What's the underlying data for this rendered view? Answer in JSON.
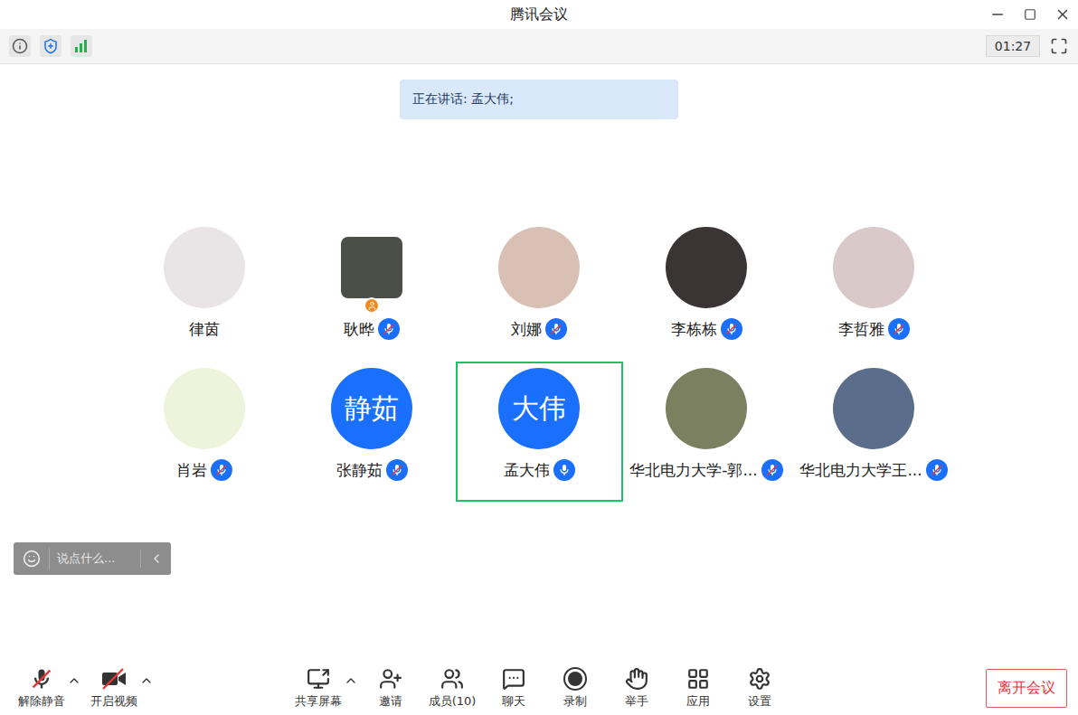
{
  "window": {
    "title": "腾讯会议"
  },
  "statusbar": {
    "timer": "01:27"
  },
  "banner": {
    "text": "正在讲话: 孟大伟;"
  },
  "participants": [
    {
      "name": "律茵",
      "kind": "photo",
      "color": "#e9e4e6",
      "mic_visible": false,
      "muted": false,
      "speaking": false,
      "selected": false,
      "host": false
    },
    {
      "name": "耿晔",
      "kind": "tile",
      "color": "#4a5048",
      "mic_visible": true,
      "muted": true,
      "speaking": false,
      "selected": false,
      "host": true
    },
    {
      "name": "刘娜",
      "kind": "photo",
      "color": "#d8c0b4",
      "mic_visible": true,
      "muted": true,
      "speaking": false,
      "selected": false,
      "host": false
    },
    {
      "name": "李栋栋",
      "kind": "photo",
      "color": "#3a3434",
      "mic_visible": true,
      "muted": true,
      "speaking": false,
      "selected": false,
      "host": false
    },
    {
      "name": "李哲雅",
      "kind": "photo",
      "color": "#d9c9c9",
      "mic_visible": true,
      "muted": true,
      "speaking": false,
      "selected": false,
      "host": false
    },
    {
      "name": "肖岩",
      "kind": "photo",
      "color": "#eef3dc",
      "mic_visible": true,
      "muted": true,
      "speaking": false,
      "selected": false,
      "host": false
    },
    {
      "name": "张静茹",
      "kind": "initials",
      "initials": "静茹",
      "color": "#1a6ffc",
      "mic_visible": true,
      "muted": true,
      "speaking": false,
      "selected": false,
      "host": false
    },
    {
      "name": "孟大伟",
      "kind": "initials",
      "initials": "大伟",
      "color": "#1a6ffc",
      "mic_visible": true,
      "muted": false,
      "speaking": true,
      "selected": true,
      "host": false
    },
    {
      "name": "华北电力大学-郭...",
      "kind": "photo",
      "color": "#7a8060",
      "mic_visible": true,
      "muted": true,
      "speaking": false,
      "selected": false,
      "host": false
    },
    {
      "name": "华北电力大学王...",
      "kind": "photo",
      "color": "#5a6e8c",
      "mic_visible": true,
      "muted": true,
      "speaking": false,
      "selected": false,
      "host": false
    }
  ],
  "chat_input": {
    "placeholder": "说点什么..."
  },
  "toolbar": {
    "left": [
      {
        "label": "解除静音",
        "kind": "unmute",
        "menu": true
      },
      {
        "label": "开启视频",
        "kind": "video",
        "menu": true
      }
    ],
    "center": [
      {
        "label": "共享屏幕",
        "kind": "share",
        "menu": true
      },
      {
        "label": "邀请",
        "kind": "invite",
        "menu": false
      },
      {
        "label": "成员(10)",
        "kind": "members",
        "menu": false
      },
      {
        "label": "聊天",
        "kind": "chat",
        "menu": false
      },
      {
        "label": "录制",
        "kind": "record",
        "menu": false
      },
      {
        "label": "举手",
        "kind": "hand",
        "menu": false
      },
      {
        "label": "应用",
        "kind": "apps",
        "menu": false
      },
      {
        "label": "设置",
        "kind": "settings",
        "menu": false
      }
    ],
    "leave": "离开会议"
  }
}
